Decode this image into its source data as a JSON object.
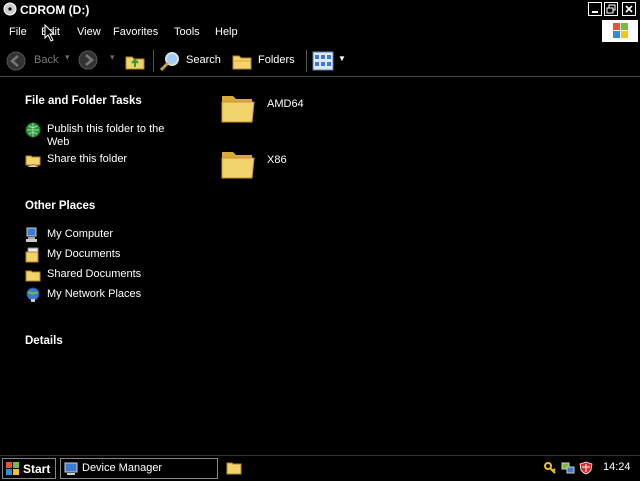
{
  "window": {
    "title": "CDROM (D:)"
  },
  "menu": {
    "file": "File",
    "edit": "Edit",
    "view": "View",
    "favorites": "Favorites",
    "tools": "Tools",
    "help": "Help"
  },
  "toolbar": {
    "back_label": "Back",
    "search_label": "Search",
    "folders_label": "Folders"
  },
  "left_pane": {
    "file_tasks": {
      "title": "File and Folder Tasks",
      "items": [
        {
          "label_line1": "Publish this folder to the",
          "label_line2": "Web",
          "icon": "publish-web-icon"
        },
        {
          "label": "Share this folder",
          "icon": "share-folder-icon"
        }
      ]
    },
    "other_places": {
      "title": "Other Places",
      "items": [
        {
          "label": "My Computer",
          "icon": "my-computer-icon"
        },
        {
          "label": "My Documents",
          "icon": "my-documents-icon"
        },
        {
          "label": "Shared Documents",
          "icon": "shared-documents-icon"
        },
        {
          "label": "My Network Places",
          "icon": "network-places-icon"
        }
      ]
    },
    "details": {
      "title": "Details"
    }
  },
  "content": {
    "folders": [
      {
        "name": "AMD64"
      },
      {
        "name": "X86"
      }
    ]
  },
  "taskbar": {
    "start_label": "Start",
    "tasks": [
      {
        "label": "Device Manager"
      }
    ],
    "clock": "14:24"
  },
  "colors": {
    "background": "#000000",
    "text": "#ffffff",
    "folder": "#f3d36b",
    "folder_dark": "#d9a93a",
    "publish": "#2d9b3c",
    "network": "#3a7bd5"
  }
}
